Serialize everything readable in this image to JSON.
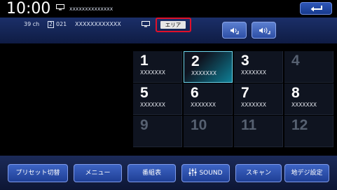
{
  "status_bar": {
    "clock": "10:00",
    "tv_icon": "tv-monitor-icon",
    "station_name": "xxxxxxxxxxxxxx"
  },
  "back_button": {
    "icon": "return-arrow-icon"
  },
  "channel_info": {
    "channel": "39 ch",
    "multi_channel_index": "2",
    "service_code": "021",
    "station_name": "XXXXXXXXXXXX",
    "tv_icon": "tv-monitor-icon",
    "area_label": "エリア"
  },
  "audio_buttons": [
    {
      "icon": "audio-switch-left-icon"
    },
    {
      "icon": "audio-switch-right-icon"
    }
  ],
  "presets": [
    {
      "number": "1",
      "station": "XXXXXXX",
      "state": "normal"
    },
    {
      "number": "2",
      "station": "XXXXXXX",
      "state": "selected"
    },
    {
      "number": "3",
      "station": "XXXXXXX",
      "state": "normal"
    },
    {
      "number": "4",
      "station": "",
      "state": "empty"
    },
    {
      "number": "5",
      "station": "XXXXXXX",
      "state": "normal"
    },
    {
      "number": "6",
      "station": "XXXXXXX",
      "state": "normal"
    },
    {
      "number": "7",
      "station": "XXXXXXX",
      "state": "normal"
    },
    {
      "number": "8",
      "station": "XXXXXXX",
      "state": "normal"
    },
    {
      "number": "9",
      "station": "",
      "state": "empty"
    },
    {
      "number": "10",
      "station": "",
      "state": "empty"
    },
    {
      "number": "11",
      "station": "",
      "state": "empty"
    },
    {
      "number": "12",
      "station": "",
      "state": "empty"
    }
  ],
  "bottom_buttons": {
    "preset_switch": "プリセット切替",
    "menu": "メニュー",
    "program_guide": "番組表",
    "sound": "SOUND",
    "scan": "スキャン",
    "digital_settings": "地デジ設定"
  },
  "colors": {
    "accent_blue": "#2d4fa6",
    "selected_cyan": "#6fd6ee",
    "area_highlight": "#e0102a"
  }
}
